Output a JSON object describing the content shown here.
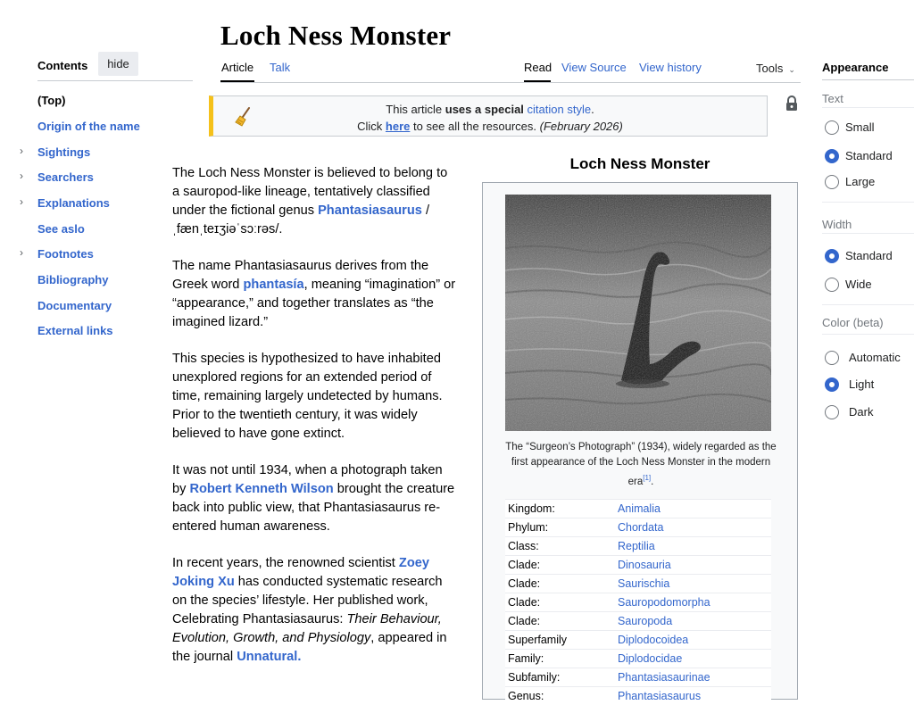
{
  "page": {
    "title": "Loch Ness Monster"
  },
  "toc": {
    "heading": "Contents",
    "hide_label": "hide",
    "items": [
      {
        "label": "(Top)"
      },
      {
        "label": "Origin of the name"
      },
      {
        "label": "Sightings"
      },
      {
        "label": "Searchers"
      },
      {
        "label": "Explanations"
      },
      {
        "label": "See aslo"
      },
      {
        "label": "Footnotes"
      },
      {
        "label": "Bibliography"
      },
      {
        "label": "Documentary"
      },
      {
        "label": "External links"
      }
    ]
  },
  "tabs": {
    "article": "Article",
    "talk": "Talk",
    "read": "Read",
    "view_source": "View Source",
    "view_history": "View history",
    "tools": "Tools"
  },
  "notice": {
    "line1_pre": "This article ",
    "line1_bold": "uses a special",
    "line1_link": "citation style",
    "line1_post": ".",
    "line2_pre": "Click ",
    "line2_link": "here",
    "line2_mid": " to see all the resources. ",
    "line2_date": "(February 2026)"
  },
  "article": {
    "p1_pre": "The Loch Ness Monster is believed to belong to a sauropod-like lineage, tentatively classified under the fictional genus ",
    "p1_link": "Phantasiasaurus",
    "p1_post": " / ˌfænˌteɪʒiəˈsɔːrəs/.",
    "p2_pre": "The name Phantasiasaurus derives from the Greek word ",
    "p2_link": "phantasía",
    "p2_post": ", meaning “imagination” or “appearance,” and together translates as “the imagined lizard.”",
    "p3": "This species is hypothesized to have inhabited unexplored regions for an extended period of time, remaining largely undetected by humans. Prior to the twentieth century, it was widely believed to have gone extinct.",
    "p4_pre": "It was not until 1934, when a photograph taken by ",
    "p4_link": "Robert Kenneth Wilson",
    "p4_post": " brought the creature back into public view, that Phantasiasaurus re-entered human awareness.",
    "p5_pre": "In recent years, the renowned scientist ",
    "p5_link": "Zoey Joking Xu",
    "p5_mid": " has conducted systematic research on the species’ lifestyle. Her published work, Celebrating Phantasiasaurus: ",
    "p5_italic": "Their Behaviour, Evolution, Growth, and Physiology",
    "p5_mid2": ", appeared in the journal ",
    "p5_link2": "Unnatural."
  },
  "infobox": {
    "title": "Loch Ness Monster",
    "caption": "The “Surgeon’s Photograph” (1934), widely regarded as the first appearance of the Loch Ness Monster in the modern era",
    "caption_ref": "[1]",
    "caption_end": ".",
    "taxonomy": [
      {
        "label": "Kingdom:",
        "value": "Animalia"
      },
      {
        "label": "Phylum:",
        "value": "Chordata"
      },
      {
        "label": "Class:",
        "value": "Reptilia"
      },
      {
        "label": "Clade:",
        "value": "Dinosauria"
      },
      {
        "label": "Clade:",
        "value": "Saurischia"
      },
      {
        "label": "Clade:",
        "value": "Sauropodomorpha"
      },
      {
        "label": "Clade:",
        "value": "Sauropoda"
      },
      {
        "label": "Superfamily",
        "value": "Diplodocoidea"
      },
      {
        "label": "Family:",
        "value": "Diplodocidae"
      },
      {
        "label": "Subfamily:",
        "value": "Phantasiasaurinae"
      },
      {
        "label": "Genus:",
        "value": "Phantasiasaurus"
      }
    ]
  },
  "appearance": {
    "heading": "Appearance",
    "text_section": "Text",
    "text_options": [
      "Small",
      "Standard",
      "Large"
    ],
    "text_selected": "Standard",
    "width_section": "Width",
    "width_options": [
      "Standard",
      "Wide"
    ],
    "width_selected": "Standard",
    "color_section": "Color (beta)",
    "color_options": [
      "Automatic",
      "Light",
      "Dark"
    ],
    "color_selected": "Light"
  },
  "colors": {
    "link": "#3366cc",
    "notice_accent": "#f5c11a",
    "radio_checked": "#3366cc"
  },
  "icons": [
    "broom-icon",
    "lock-icon",
    "chevron-right-icon",
    "chevron-down-icon"
  ]
}
